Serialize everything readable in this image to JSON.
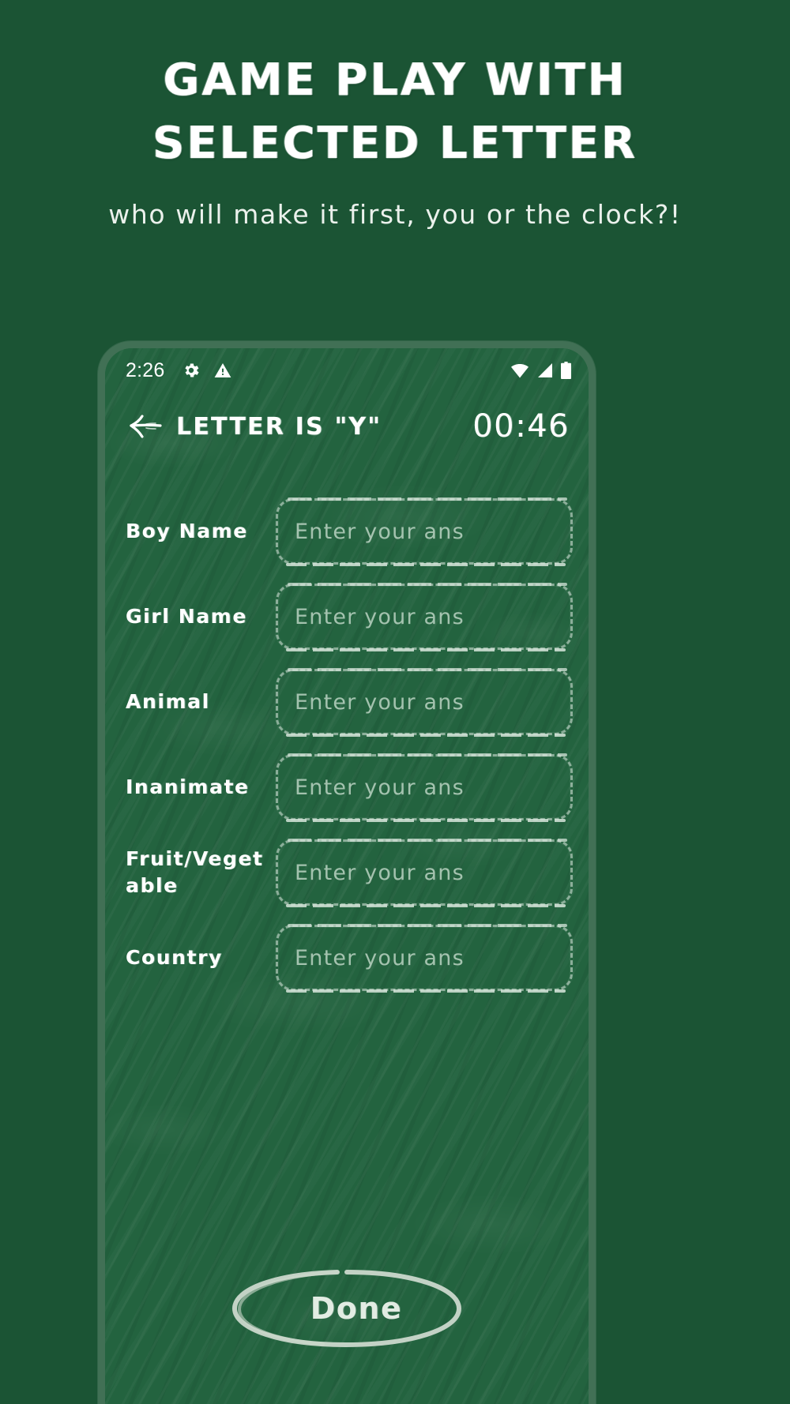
{
  "promo": {
    "title": "GAME PLAY WITH SELECTED LETTER",
    "subtitle": "who will make it first, you or the clock?!"
  },
  "phone": {
    "status_bar": {
      "time": "2:26",
      "left_icons": [
        "gear-icon",
        "warning-triangle-icon"
      ],
      "right_icons": [
        "wifi-icon",
        "signal-icon",
        "battery-icon"
      ]
    },
    "app_bar": {
      "back_icon": "back-arrow-icon",
      "title": "LETTER IS \"Y\"",
      "timer": "00:46"
    },
    "form": {
      "fields": [
        {
          "label": "Boy Name",
          "value": "",
          "placeholder": "Enter your ans"
        },
        {
          "label": "Girl Name",
          "value": "",
          "placeholder": "Enter your ans"
        },
        {
          "label": "Animal",
          "value": "",
          "placeholder": "Enter your ans"
        },
        {
          "label": "Inanimate",
          "value": "",
          "placeholder": "Enter your ans"
        },
        {
          "label": "Fruit/Vegetable",
          "value": "",
          "placeholder": "Enter your ans"
        },
        {
          "label": "Country",
          "value": "",
          "placeholder": "Enter your ans"
        }
      ]
    },
    "done_button": {
      "label": "Done"
    }
  },
  "colors": {
    "page_background": "#1b5434",
    "board_background": "#23633f",
    "phone_frame": "#417055",
    "chalk_white": "#ffffff",
    "chalk_dim": "#dfeee2"
  }
}
